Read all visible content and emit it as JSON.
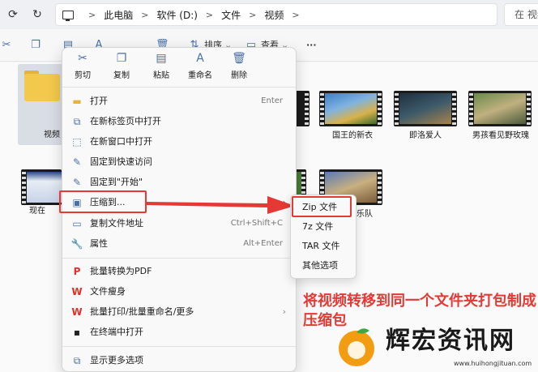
{
  "address_bar": {
    "crumbs": [
      "此电脑",
      "软件 (D:)",
      "文件",
      "视频"
    ],
    "search_placeholder": "在 视频"
  },
  "toolbar": {
    "sort_label": "排序",
    "view_label": "查看",
    "more_label": "···"
  },
  "files": [
    {
      "name": "视频",
      "type": "folder"
    },
    {
      "name": "国王的新衣",
      "type": "video"
    },
    {
      "name": "即洛爱人",
      "type": "video"
    },
    {
      "name": "男孩看见野玫瑰",
      "type": "video"
    },
    {
      "name": "现在",
      "type": "video"
    },
    {
      "name": "乐队",
      "type": "video"
    }
  ],
  "context_menu": {
    "quick_actions": [
      {
        "label": "剪切",
        "icon": "scissors-icon"
      },
      {
        "label": "复制",
        "icon": "copy-icon"
      },
      {
        "label": "粘贴",
        "icon": "paste-icon"
      },
      {
        "label": "重命名",
        "icon": "rename-icon"
      },
      {
        "label": "删除",
        "icon": "trash-icon"
      }
    ],
    "items": [
      {
        "label": "打开",
        "shortcut": "Enter",
        "icon": "folder-open-icon"
      },
      {
        "label": "在新标签页中打开",
        "shortcut": "",
        "icon": "new-tab-icon"
      },
      {
        "label": "在新窗口中打开",
        "shortcut": "",
        "icon": "new-window-icon"
      },
      {
        "label": "固定到快速访问",
        "shortcut": "",
        "icon": "pin-icon"
      },
      {
        "label": "固定到\"开始\"",
        "shortcut": "",
        "icon": "pin-start-icon"
      },
      {
        "label": "压缩到...",
        "shortcut": "",
        "icon": "zip-icon"
      },
      {
        "label": "复制文件地址",
        "shortcut": "Ctrl+Shift+C",
        "icon": "copy-path-icon"
      },
      {
        "label": "属性",
        "shortcut": "Alt+Enter",
        "icon": "wrench-icon"
      },
      {
        "label": "批量转换为PDF",
        "shortcut": "",
        "icon": "wps-pdf-icon"
      },
      {
        "label": "文件瘦身",
        "shortcut": "",
        "icon": "wps-icon"
      },
      {
        "label": "批量打印/批量重命名/更多",
        "shortcut": "",
        "icon": "wps-icon"
      },
      {
        "label": "在终端中打开",
        "shortcut": "",
        "icon": "terminal-icon"
      },
      {
        "label": "显示更多选项",
        "shortcut": "",
        "icon": "more-options-icon"
      }
    ]
  },
  "submenu": {
    "items": [
      "Zip 文件",
      "7z 文件",
      "TAR 文件",
      "其他选项"
    ]
  },
  "caption": {
    "text": "将视频转移到同一个文件夹打包制成压缩包"
  },
  "watermark": {
    "text": "辉宏资讯网",
    "url": "www.huihongjituan.com"
  },
  "colors": {
    "highlight_red": "#e53935",
    "folder_yellow": "#f2c94c",
    "accent_blue": "#4a6fa5"
  }
}
